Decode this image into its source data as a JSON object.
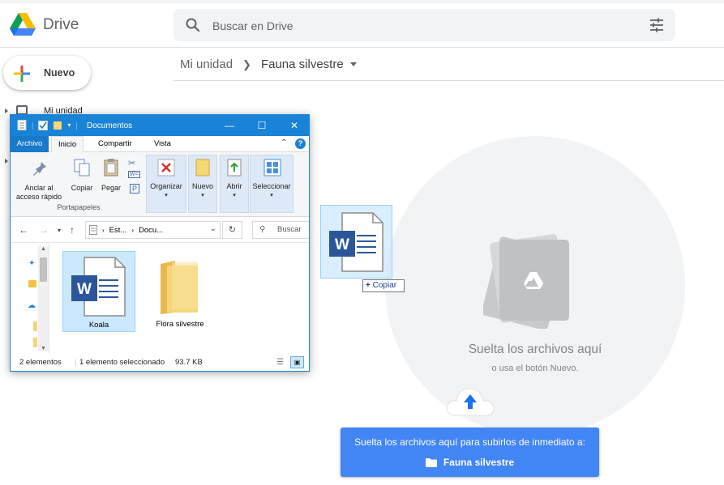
{
  "drive": {
    "brand": "Drive",
    "search_placeholder": "Buscar en Drive",
    "new_button": "Nuevo",
    "sidebar_partial_label": "Mi unidad",
    "breadcrumb": {
      "root": "Mi unidad",
      "current": "Fauna silvestre"
    },
    "dropzone": {
      "title": "Suelta los archivos aquí",
      "subtitle": "o usa el botón Nuevo."
    },
    "banner": {
      "line1": "Suelta los archivos aquí para subirlos de inmediato a:",
      "folder": "Fauna silvestre"
    },
    "colors": {
      "accent": "#4285f4",
      "drop_circle": "#f1f3f4"
    }
  },
  "drag": {
    "tooltip_plus": "+",
    "tooltip_label": "Copiar"
  },
  "explorer": {
    "title": "Documentos",
    "tabs": {
      "file": "Archivo",
      "home": "Inicio",
      "share": "Compartir",
      "view": "Vista"
    },
    "ribbon": {
      "pin": "Anclar al acceso rápido",
      "copy": "Copiar",
      "paste": "Pegar",
      "clipboard_group": "Portapapeles",
      "organize": "Organizar",
      "new": "Nuevo",
      "open": "Abrir",
      "select": "Seleccionar"
    },
    "address": {
      "part1": "Est...",
      "part2": "Docu..."
    },
    "search_placeholder": "Buscar en",
    "items": [
      {
        "name": "Koala",
        "type": "word-document",
        "selected": true
      },
      {
        "name": "Flora silvestre",
        "type": "folder",
        "selected": false
      }
    ],
    "status": {
      "count": "2 elementos",
      "selection": "1 elemento seleccionado",
      "size": "93.7 KB"
    }
  }
}
